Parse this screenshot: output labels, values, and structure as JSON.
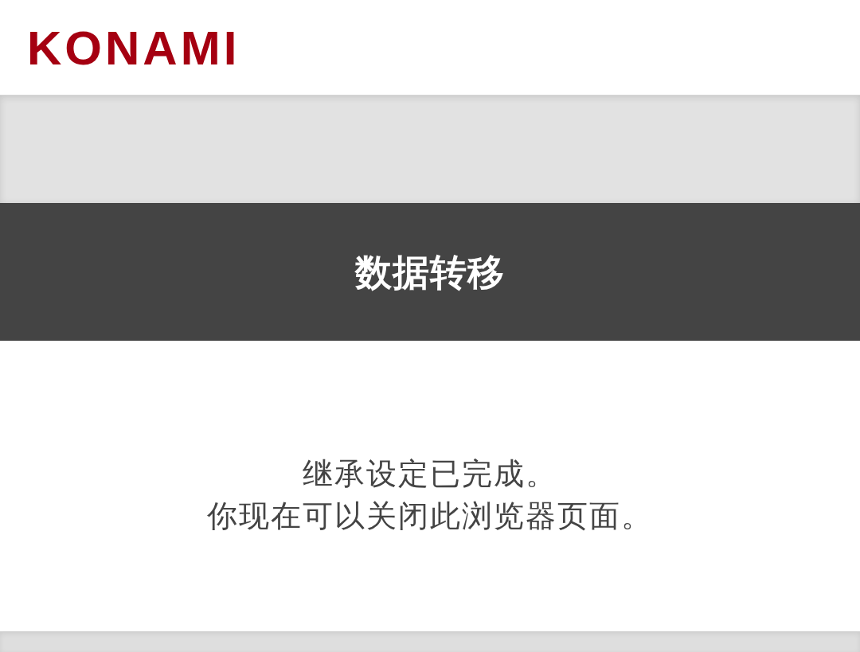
{
  "header": {
    "logo": "KONAMI"
  },
  "title_bar": {
    "title": "数据转移"
  },
  "message": {
    "lines": [
      "继承设定已完成。",
      "你现在可以关闭此浏览器页面。"
    ]
  }
}
